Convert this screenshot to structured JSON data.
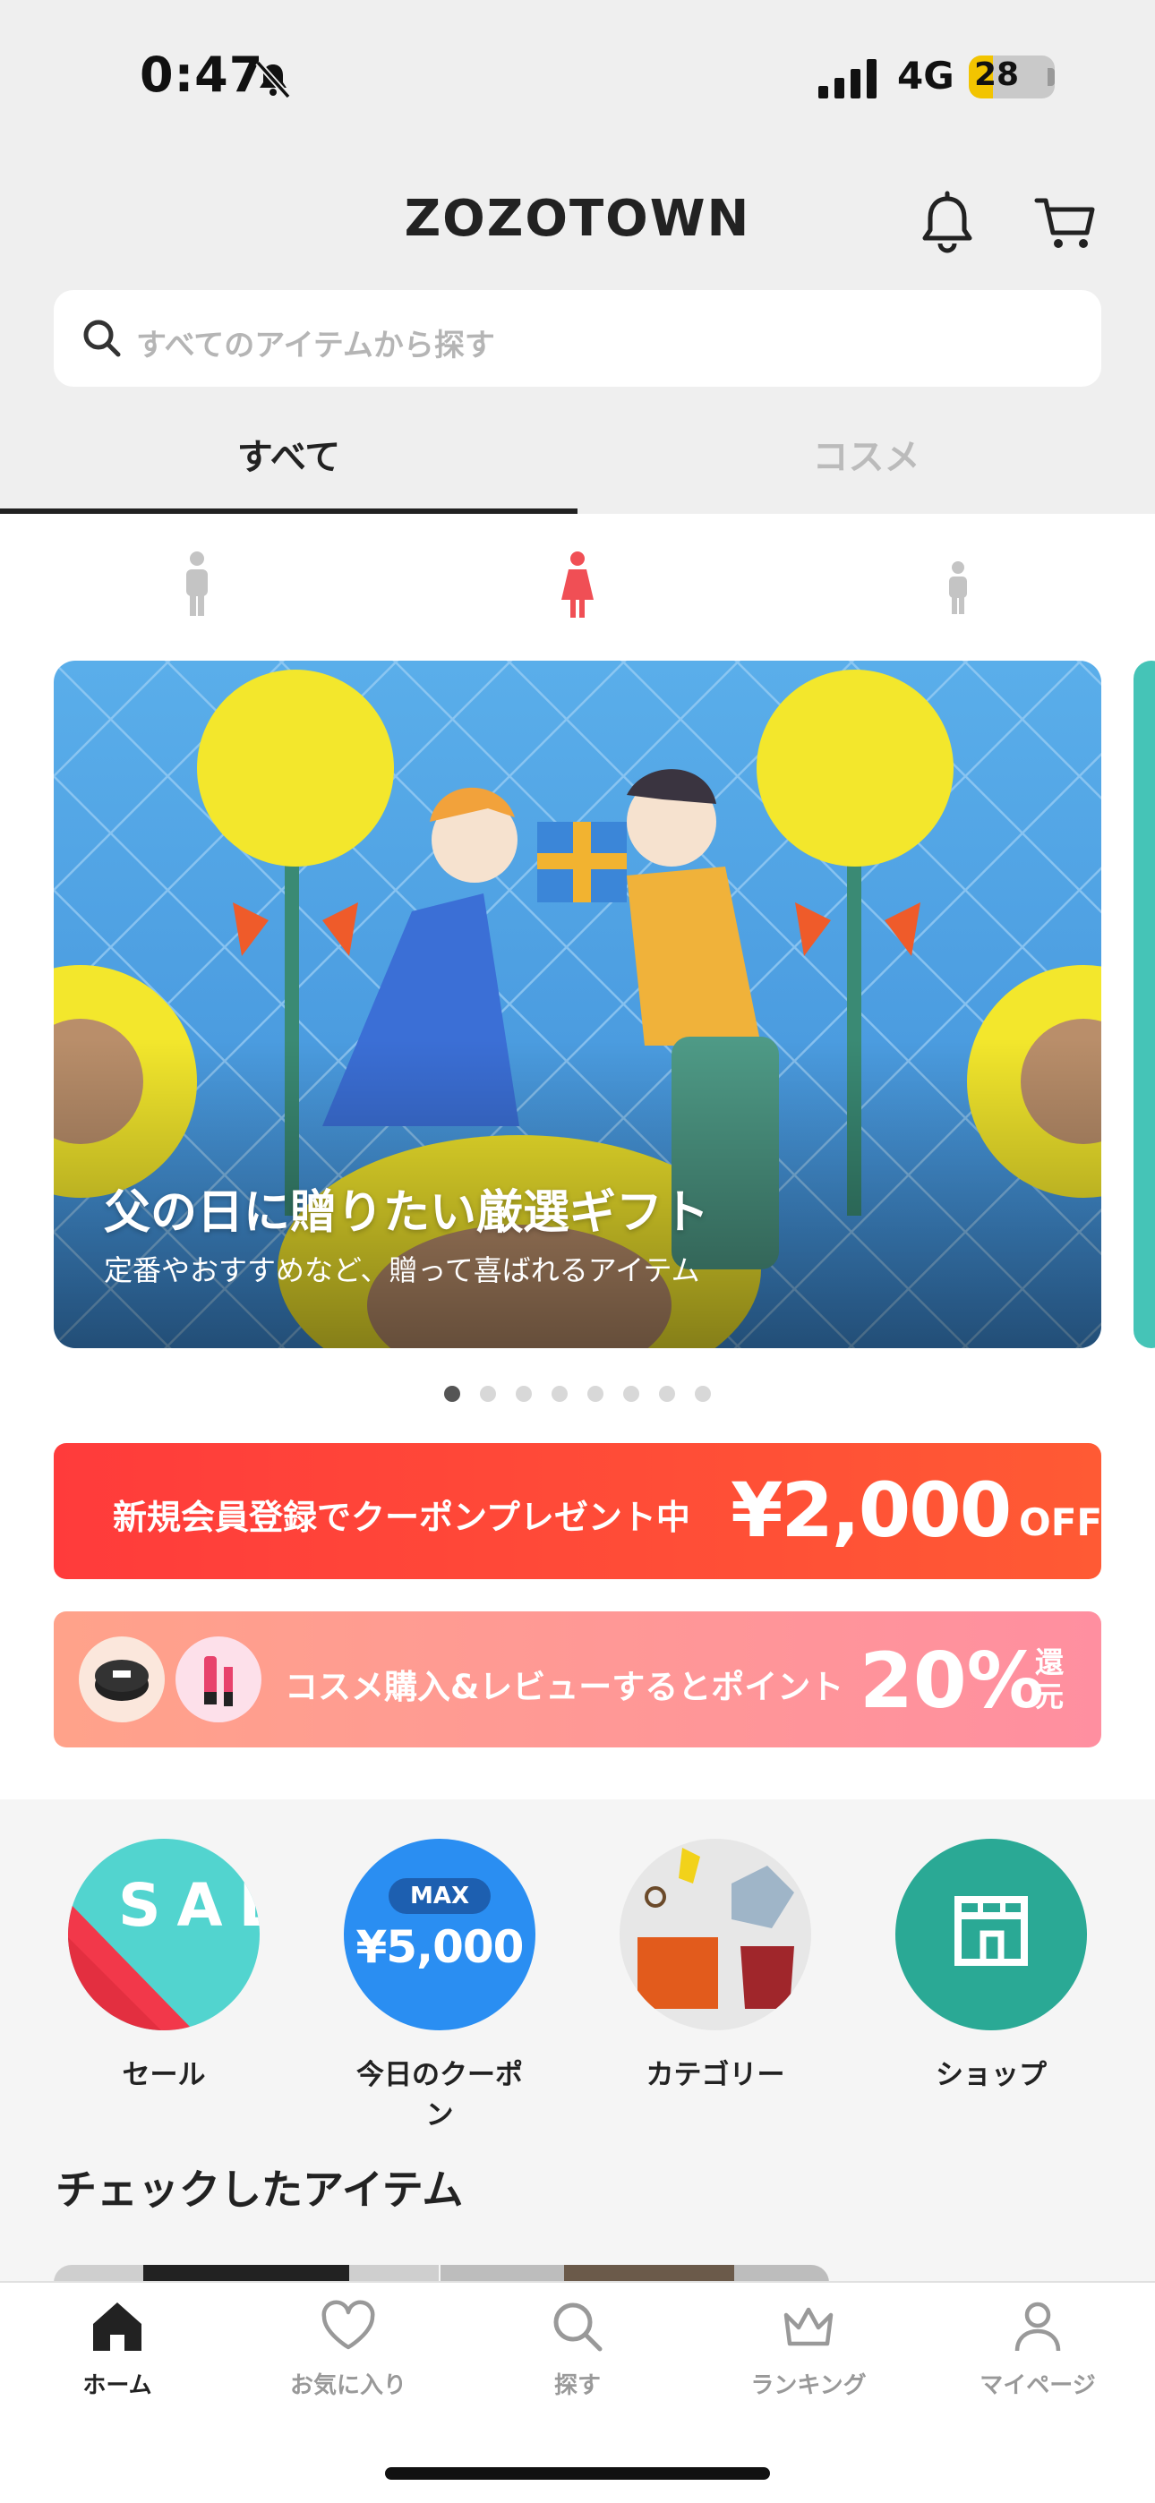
{
  "status": {
    "time": "0:47",
    "network": "4G",
    "battery": "28",
    "battery_level": 0.28
  },
  "header": {
    "logo": "ZOZOTOWN",
    "icons": [
      "bell-icon",
      "cart-icon"
    ]
  },
  "search": {
    "placeholder": "すべてのアイテムから探す"
  },
  "tabs": [
    {
      "label": "すべて",
      "active": true
    },
    {
      "label": "コスメ",
      "active": false
    }
  ],
  "gender_filters": [
    "men-icon",
    "women-icon",
    "kids-icon"
  ],
  "banner": {
    "title": "父の日に贈りたい厳選ギフト",
    "subtitle": "定番やおすすめなど、贈って喜ばれるアイテム",
    "page_count": 8,
    "current_page": 1
  },
  "promo_coupon": {
    "text": "新規会員登録でクーポンプレゼント中",
    "amount": "¥2,000",
    "suffix": "OFF"
  },
  "promo_cosme": {
    "text": "コスメ購入&レビューするとポイント",
    "percent": "20%",
    "suffix": "還元"
  },
  "quick_links": [
    {
      "label": "セール",
      "badge": "SALE"
    },
    {
      "label": "今日のクーポン",
      "badge_top": "MAX",
      "badge_amount": "¥5,000"
    },
    {
      "label": "カテゴリー"
    },
    {
      "label": "ショップ"
    }
  ],
  "checked_items": {
    "title": "チェックしたアイテム"
  },
  "tabbar": [
    {
      "label": "ホーム",
      "icon": "home-icon",
      "active": true
    },
    {
      "label": "お気に入り",
      "icon": "heart-icon",
      "active": false
    },
    {
      "label": "探す",
      "icon": "search-icon",
      "active": false
    },
    {
      "label": "ランキング",
      "icon": "crown-icon",
      "active": false
    },
    {
      "label": "マイページ",
      "icon": "user-icon",
      "active": false
    }
  ],
  "colors": {
    "accent": "#ff3b3b",
    "teal": "#2aa995",
    "blue": "#2a8ef2"
  }
}
